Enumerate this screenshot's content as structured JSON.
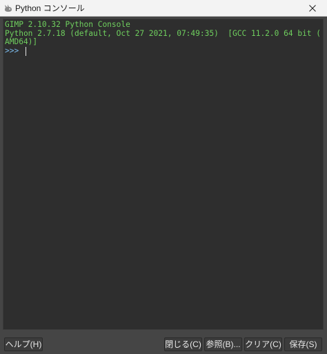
{
  "window": {
    "title": "Python コンソール",
    "app_icon": "gimp-wilber-icon",
    "close_icon": "close-icon"
  },
  "console": {
    "lines": [
      "GIMP 2.10.32 Python Console",
      "Python 2.7.18 (default, Oct 27 2021, 07:49:35)  [GCC 11.2.0 64 bit (",
      "AMD64)]"
    ],
    "prompt": ">>> ",
    "input_value": ""
  },
  "buttons": {
    "help": "ヘルプ(H)",
    "close": "閉じる(C)",
    "browse": "参照(B)...",
    "clear": "クリア(C)",
    "save": "保存(S)"
  },
  "colors": {
    "console_background": "#2e2e2e",
    "console_text": "#6fcf5e",
    "prompt_text": "#7ab8e8",
    "window_background": "#454545",
    "titlebar_background": "#f3f3f3"
  }
}
